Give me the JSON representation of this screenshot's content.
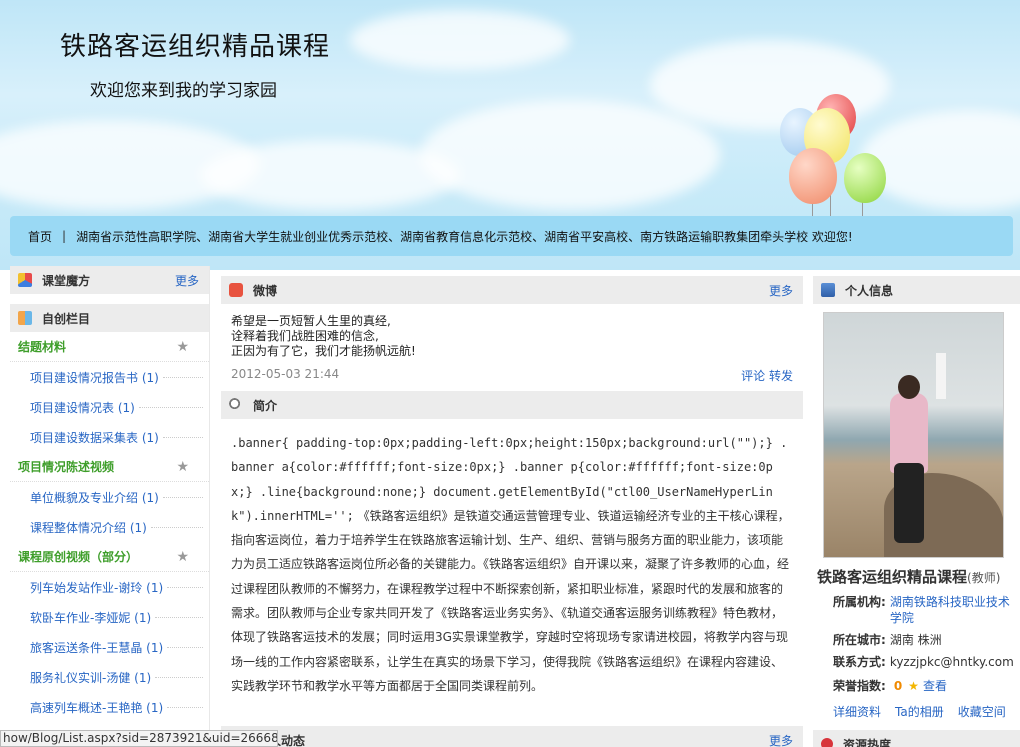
{
  "banner": {
    "title": "铁路客运组织精品课程",
    "subtitle": "欢迎您来到我的学习家园"
  },
  "nav": {
    "home": "首页",
    "separator": "|",
    "text": "湖南省示范性高职学院、湖南省大学生就业创业优秀示范校、湖南省教育信息化示范校、湖南省平安高校、南方铁路运输职教集团牵头学校 欢迎您!"
  },
  "left": {
    "classroom": {
      "title": "课堂魔方",
      "more": "更多"
    },
    "custom": {
      "title": "自创栏目"
    },
    "categories": [
      {
        "name": "结题材料",
        "items": [
          "项目建设情况报告书 (1)",
          "项目建设情况表 (1)",
          "项目建设数据采集表 (1)"
        ]
      },
      {
        "name": "项目情况陈述视频",
        "items": [
          "单位概貌及专业介绍 (1)",
          "课程整体情况介绍 (1)"
        ]
      },
      {
        "name": "课程原创视频（部分）",
        "items": [
          "列车始发站作业-谢玲 (1)",
          "软卧车作业-李娅妮 (1)",
          "旅客运送条件-王慧晶 (1)",
          "服务礼仪实训-汤健 (1)",
          "高速列车概述-王艳艳 (1)"
        ]
      }
    ]
  },
  "weibo": {
    "title": "微博",
    "more": "更多",
    "lines": [
      "希望是一页短暂人生里的真经,",
      "诠释着我们战胜困难的信念,",
      "正因为有了它，我们才能扬帆远航!"
    ],
    "time": "2012-05-03 21:44",
    "comment": "评论",
    "forward": "转发"
  },
  "intro": {
    "title": "简介",
    "code": ".banner{ padding-top:0px;padding-left:0px;height:150px;background:url(\"\");} .banner a{color:#ffffff;font-size:0px;} .banner p{color:#ffffff;font-size:0px;} .line{background:none;} document.getElementById(\"ctl00_UserNameHyperLink\").innerHTML='';",
    "text": "《铁路客运组织》是铁道交通运营管理专业、铁道运输经济专业的主干核心课程，指向客运岗位，着力于培养学生在铁路旅客运输计划、生产、组织、营销与服务方面的职业能力，该项能力为员工适应铁路客运岗位所必备的关键能力。《铁路客运组织》自开课以来，凝聚了许多教师的心血，经过课程团队教师的不懈努力，在课程教学过程中不断探索创新，紧扣职业标准，紧跟时代的发展和旅客的需求。团队教师与企业专家共同开发了《铁路客运业务实务》、《轨道交通客运服务训练教程》特色教材，体现了铁路客运技术的发展；同时运用3G实景课堂教学，穿越时空将现场专家请进校园，将教学内容与现场一线的工作内容紧密联系，让学生在真实的场景下学习，使得我院《铁路客运组织》在课程内容建设、实践教学环节和教学水平等方面都居于全国同类课程前列。"
  },
  "next_section": {
    "title": "人动态",
    "more": "更多"
  },
  "profile": {
    "title": "个人信息",
    "name": "铁路客运组织精品课程",
    "role": "(教师)",
    "org_label": "所属机构:",
    "org": "湖南铁路科技职业技术学院",
    "city_label": "所在城市:",
    "city": "湖南 株洲",
    "contact_label": "联系方式:",
    "contact": "kyzzjpkc@hntky.com",
    "honor_label": "荣誉指数:",
    "honor": "0",
    "view": "查看",
    "links": [
      "详细资料",
      "Ta的相册",
      "收藏空间"
    ],
    "resource_title": "资源热度"
  },
  "status": {
    "url": "how/Blog/List.aspx?sid=2873921&uid=266686"
  }
}
